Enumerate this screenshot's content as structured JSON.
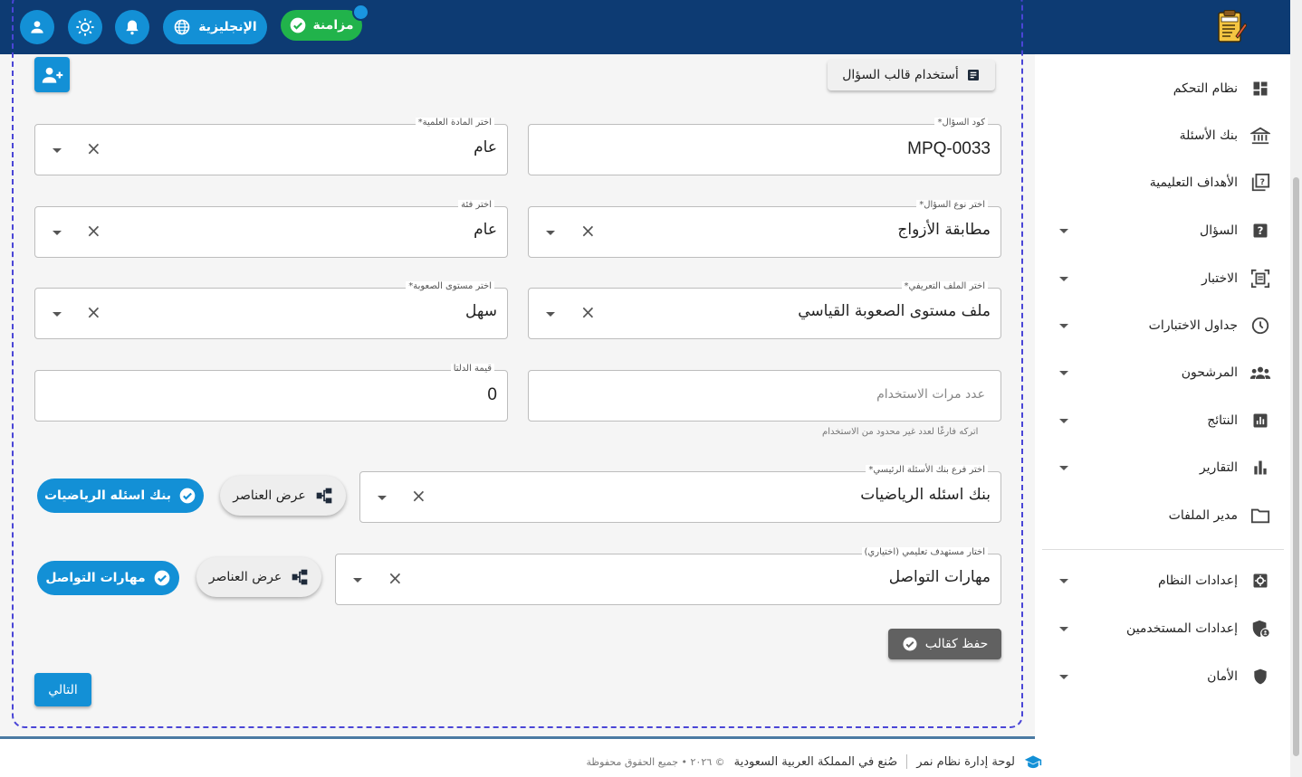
{
  "header": {
    "language_label": "الإنجليزية",
    "sync_label": "مزامنة"
  },
  "sidebar": {
    "items": [
      {
        "label": "نظام التحكم",
        "icon": "dashboard-icon",
        "has_caret": false
      },
      {
        "label": "بنك الأسئلة",
        "icon": "bank-icon",
        "has_caret": false
      },
      {
        "label": "الأهداف التعليمية",
        "icon": "quiz-book-icon",
        "has_caret": false
      },
      {
        "label": "السؤال",
        "icon": "question-icon",
        "has_caret": true
      },
      {
        "label": "الاختبار",
        "icon": "document-scanner-icon",
        "has_caret": true
      },
      {
        "label": "جداول الاختبارات",
        "icon": "clock-icon",
        "has_caret": true
      },
      {
        "label": "المرشحون",
        "icon": "group-icon",
        "has_caret": true
      },
      {
        "label": "النتائج",
        "icon": "chart-box-icon",
        "has_caret": true
      },
      {
        "label": "التقارير",
        "icon": "bar-chart-icon",
        "has_caret": true
      },
      {
        "label": "مدير الملفات",
        "icon": "folder-icon",
        "has_caret": false
      },
      {
        "label": "إعدادات النظام",
        "icon": "settings-icon",
        "has_caret": true
      },
      {
        "label": "إعدادات المستخدمين",
        "icon": "user-shield-icon",
        "has_caret": true
      },
      {
        "label": "الأمان",
        "icon": "shield-icon",
        "has_caret": true
      }
    ]
  },
  "form": {
    "template_button": "أستخدام قالب السؤال",
    "question_code_label": "كود السؤال*",
    "question_code_value": "MPQ-0033",
    "subject_label": "اختر المادة العلمية*",
    "subject_value": "عام",
    "question_type_label": "اختر نوع السؤال*",
    "question_type_value": "مطابقة الأزواج",
    "category_label": "اختر فئة",
    "category_value": "عام",
    "profile_label": "اختر الملف التعريفي*",
    "profile_value": "ملف مستوى الصعوبة القياسي",
    "difficulty_label": "اختر مستوى الصعوبة*",
    "difficulty_value": "سهل",
    "usage_placeholder": "عدد مرات الاستخدام",
    "usage_helper": "اتركه فارغًا لعدد غير محدود من الاستخدام",
    "delta_label": "قيمة الدلتا",
    "delta_value": "0",
    "branch_label": "اختر فرع بنك الأسئلة الرئيسي*",
    "branch_value": "بنك اسئله الرياضيات",
    "branch_chip": "بنك اسئله الرياضيات",
    "view_items_label": "عرض العناصر",
    "objective_label": "اختار مستهدف تعليمي (اختياري)",
    "objective_value": "مهارات التواصل",
    "objective_chip": "مهارات التواصل",
    "save_template": "حفظ كقالب",
    "next": "التالي"
  },
  "footer": {
    "app_name": "لوحة إدارة نظام نمر",
    "made_in": "صُنع في المملكة العربية السعودية",
    "copyright": "© ٢٠٢٦ • جميع الحقوق محفوظة"
  },
  "colors": {
    "topbar": "#0d3b73",
    "primary": "#1390d6",
    "sync": "#21b34b",
    "dashed_frame": "#4a45d6"
  }
}
